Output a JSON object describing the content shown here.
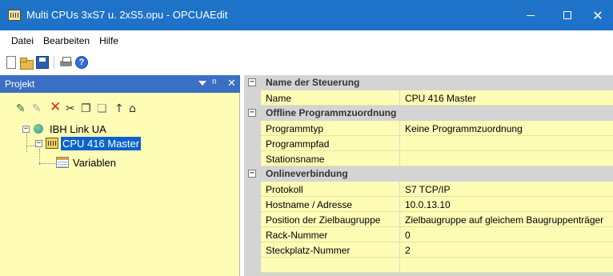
{
  "window": {
    "title": "Multi CPUs 3xS7 u. 2xS5.opu - OPCUAEdit",
    "minimize_glyph": "",
    "maximize_glyph": "",
    "close_glyph": "✕"
  },
  "menu": {
    "items": [
      "Datei",
      "Bearbeiten",
      "Hilfe"
    ]
  },
  "toolbar": {
    "icons": [
      "new-file-icon",
      "open-folder-icon",
      "save-icon",
      "print-icon",
      "help-icon"
    ],
    "help_glyph": "?"
  },
  "project_panel": {
    "title": "Projekt",
    "pin_glyph": "ᴨ",
    "close_glyph": "✕",
    "toolbar": {
      "new_node_glyph": "✎",
      "edit_glyph": "✎",
      "delete_glyph": "✕",
      "cut_glyph": "✂",
      "copy_glyph": "❐",
      "paste_glyph": "❏",
      "up_glyph": "↑",
      "home_glyph": "⌂"
    },
    "tree": [
      {
        "label": "IBH Link UA",
        "expander": "−",
        "icon": "network-globe-icon",
        "selected": false
      },
      {
        "label": "CPU 416 Master",
        "expander": "−",
        "icon": "cpu-icon",
        "selected": true
      },
      {
        "label": "Variablen",
        "expander": "",
        "icon": "table-icon",
        "selected": false
      }
    ]
  },
  "properties": {
    "collapse_glyph": "−",
    "categories": [
      {
        "label": "Name der Steuerung",
        "rows": [
          {
            "name": "Name",
            "value": "CPU 416 Master"
          }
        ]
      },
      {
        "label": "Offline Programmzuordnung",
        "rows": [
          {
            "name": "Programmtyp",
            "value": "Keine Programmzuordnung"
          },
          {
            "name": "Programmpfad",
            "value": ""
          },
          {
            "name": "Stationsname",
            "value": ""
          }
        ]
      },
      {
        "label": "Onlineverbindung",
        "rows": [
          {
            "name": "Protokoll",
            "value": "S7 TCP/IP"
          },
          {
            "name": "Hostname / Adresse",
            "value": "10.0.13.10"
          },
          {
            "name": "Position der Zielbaugruppe",
            "value": "Zielbaugruppe auf gleichem Baugruppenträger"
          },
          {
            "name": "Rack-Nummer",
            "value": "0"
          },
          {
            "name": "Steckplatz-Nummer",
            "value": "2"
          }
        ]
      }
    ]
  },
  "colors": {
    "titlebar": "#1e73c9",
    "panel_header": "#3b6fc4",
    "panel_background": "#fffcb6",
    "selection": "#0a63c9",
    "category_background": "#d4d4d4"
  }
}
